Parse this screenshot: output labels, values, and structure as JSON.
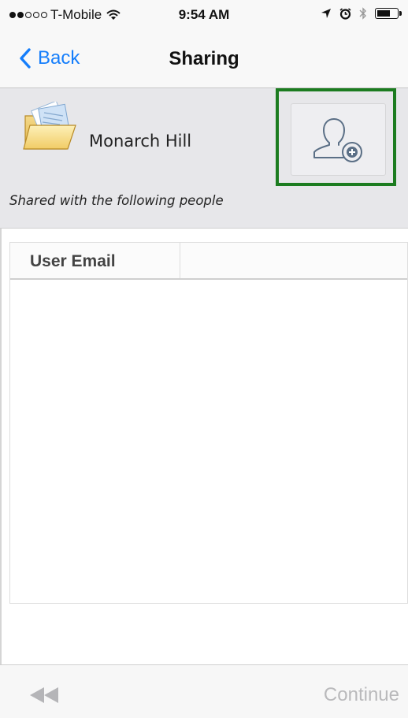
{
  "status_bar": {
    "carrier": "T-Mobile",
    "time": "9:54 AM",
    "signal_filled": 2,
    "signal_total": 5,
    "battery_level": 0.7,
    "icons": [
      "wifi-icon",
      "location-icon",
      "alarm-icon",
      "bluetooth-icon",
      "battery-icon"
    ]
  },
  "nav": {
    "back_label": "Back",
    "title": "Sharing"
  },
  "header": {
    "folder_name": "Monarch Hill",
    "caption": "Shared with the following people",
    "add_user_icon": "add-user-icon",
    "highlight_color": "#1c7c20"
  },
  "table": {
    "columns": [
      "User Email",
      ""
    ],
    "rows": []
  },
  "toolbar": {
    "rewind_icon": "rewind-icon",
    "continue_label": "Continue"
  },
  "colors": {
    "accent": "#157efb",
    "disabled": "#b9b9bb",
    "header_bg": "#e7e7ea"
  }
}
